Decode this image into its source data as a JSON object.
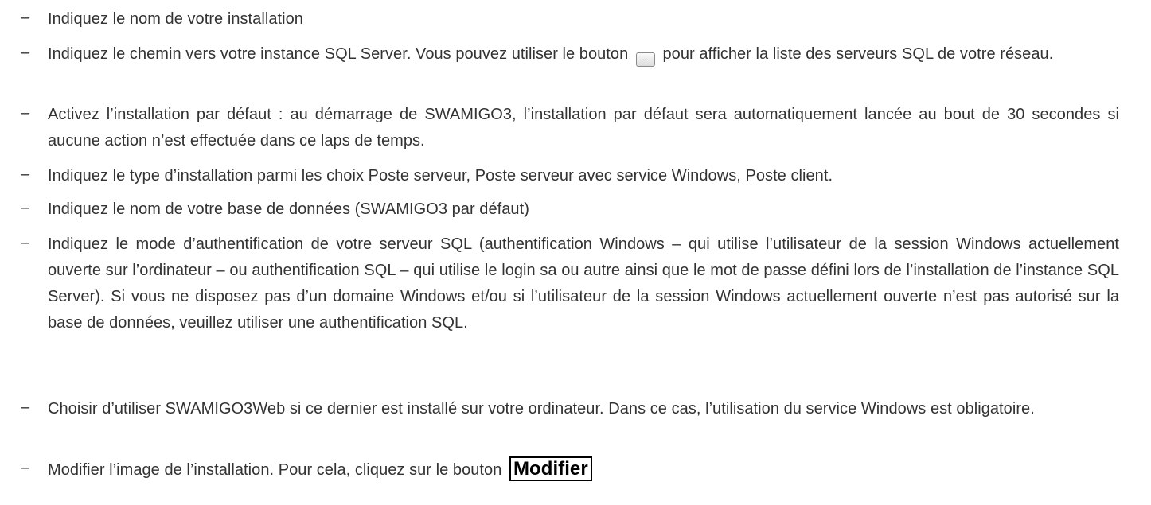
{
  "bullet": "–",
  "items": [
    {
      "text": "Indiquez le nom de votre installation"
    },
    {
      "text_before": "Indiquez le chemin vers votre instance SQL Server. Vous pouvez utiliser le bouton",
      "button_label": "...",
      "text_after": "pour afficher la liste des serveurs SQL de votre réseau."
    },
    {
      "text": "Activez l’installation par défaut : au démarrage de SWAMIGO3, l’installation par défaut sera automatiquement lancée au bout de 30 secondes si aucune action n’est effectuée dans ce laps de temps."
    },
    {
      "text": "Indiquez le type d’installation parmi les choix Poste serveur, Poste serveur avec service Windows, Poste client."
    },
    {
      "text": "Indiquez le nom de votre base de données (SWAMIGO3 par défaut)"
    },
    {
      "text": "Indiquez le mode d’authentification de votre serveur SQL (authentification Windows – qui utilise l’utilisateur de la session Windows actuellement ouverte sur l’ordinateur – ou authentification SQL – qui utilise le login sa ou autre ainsi que le mot de passe défini lors de l’installation de l’instance SQL Server). Si vous ne disposez pas d’un domaine Windows et/ou si l’utilisateur de la session Windows actuellement ouverte n’est pas autorisé sur la base de données, veuillez utiliser une authentification SQL."
    },
    {
      "text": "Choisir d’utiliser SWAMIGO3Web si ce dernier est installé sur votre ordinateur. Dans ce cas, l’utilisation du service Windows est obligatoire."
    },
    {
      "text_before": "Modifier l’image de l’installation. Pour cela, cliquez sur le bouton",
      "button_label": "Modifier"
    }
  ]
}
